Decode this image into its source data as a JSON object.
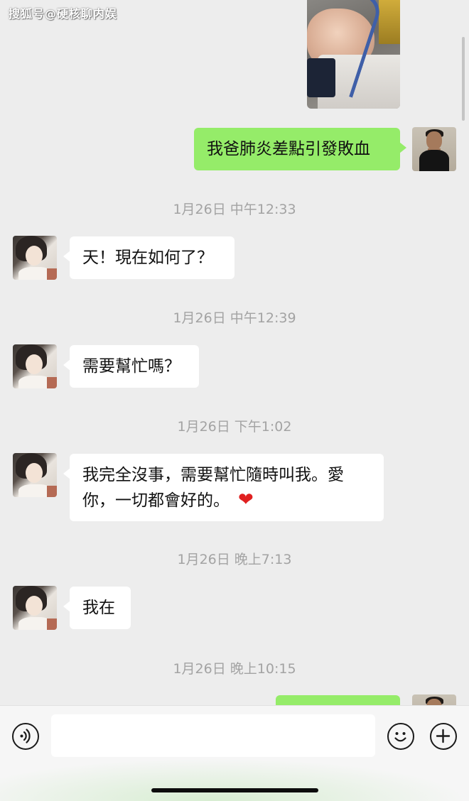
{
  "watermark": "搜狐号@硬核聊内娱",
  "messages": [
    {
      "from": "me",
      "type": "text",
      "text": "我爸肺炎差點引發敗血"
    },
    {
      "from": "them",
      "type": "text",
      "timestamp": "1月26日 中午12:33",
      "text": "天！現在如何了？"
    },
    {
      "from": "them",
      "type": "text",
      "timestamp": "1月26日 中午12:39",
      "text": "需要幫忙嗎？"
    },
    {
      "from": "them",
      "type": "text",
      "timestamp": "1月26日 下午1:02",
      "line1": "我完全沒事，需要幫忙隨時叫我。愛",
      "line2": "你，一切都會好的。",
      "emoji": "❤"
    },
    {
      "from": "them",
      "type": "text",
      "timestamp": "1月26日 晚上7:13",
      "text": "我在"
    },
    {
      "from": "me",
      "type": "text",
      "timestamp": "1月26日 晚上10:15",
      "text": ""
    }
  ],
  "input_bar": {
    "voice_icon": "voice-icon",
    "emoji_icon": "emoji-icon",
    "add_icon": "add-icon"
  },
  "colors": {
    "background": "#ededed",
    "outgoing_bubble": "#95ec69",
    "incoming_bubble": "#ffffff",
    "timestamp_text": "#a3a3a3"
  }
}
